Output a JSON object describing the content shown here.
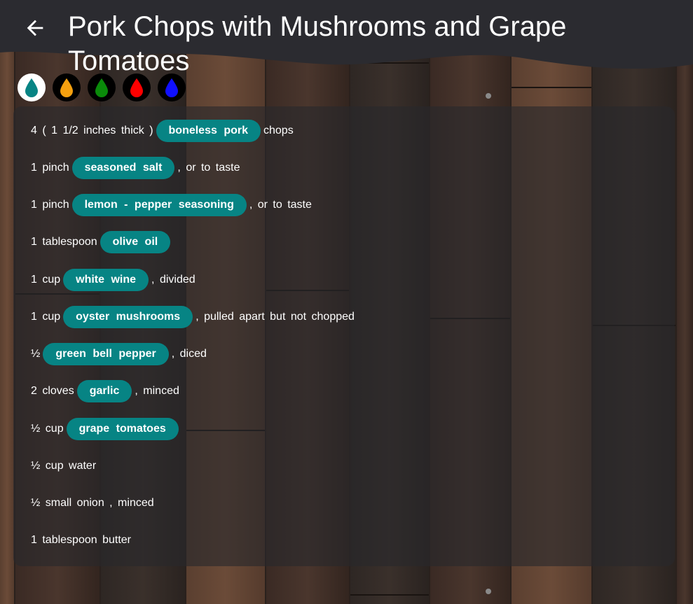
{
  "header": {
    "title": "Pork Chops with Mushrooms and Grape Tomatoes",
    "back_icon": "arrow-left-icon"
  },
  "color_dots": [
    {
      "color": "#078484",
      "selected": true
    },
    {
      "color": "#f5a00f"
    },
    {
      "color": "#0a8a0a"
    },
    {
      "color": "#ff0000"
    },
    {
      "color": "#1010ff"
    }
  ],
  "ingredients": [
    {
      "pre": "4 ( 1 1/2 inches thick )",
      "chip": "boneless pork",
      "post": "chops"
    },
    {
      "pre": "1 pinch",
      "chip": "seasoned salt",
      "post": ", or to taste"
    },
    {
      "pre": "1 pinch",
      "chip": "lemon - pepper seasoning",
      "post": ", or to taste"
    },
    {
      "pre": "1 tablespoon",
      "chip": "olive oil",
      "post": ""
    },
    {
      "pre": "1 cup",
      "chip": "white wine",
      "post": ", divided"
    },
    {
      "pre": "1 cup",
      "chip": "oyster mushrooms",
      "post": ", pulled apart but not chopped"
    },
    {
      "pre": "½",
      "chip": "green bell pepper",
      "post": ", diced"
    },
    {
      "pre": "2 cloves",
      "chip": "garlic",
      "post": ", minced"
    },
    {
      "pre": "½ cup",
      "chip": "grape tomatoes",
      "post": ""
    },
    {
      "pre": "½ cup water",
      "chip": "",
      "post": ""
    },
    {
      "pre": "½ small onion , minced",
      "chip": "",
      "post": ""
    },
    {
      "pre": "1 tablespoon butter",
      "chip": "",
      "post": ""
    }
  ]
}
